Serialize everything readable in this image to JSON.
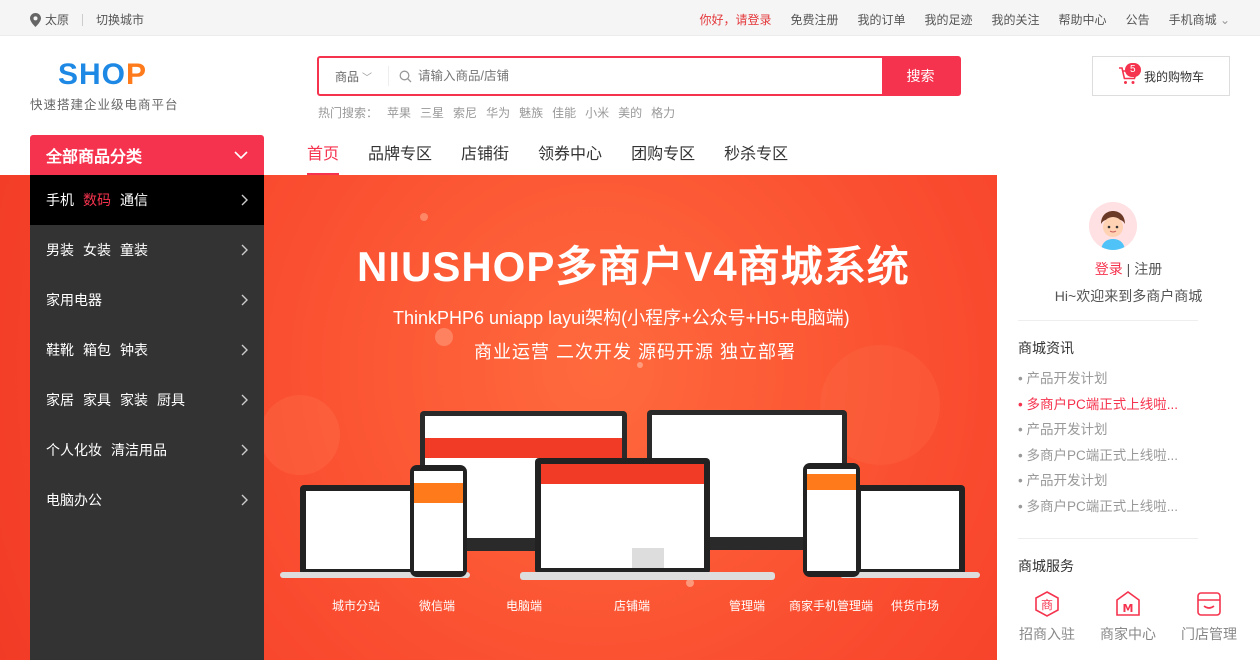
{
  "topbar": {
    "city": "太原",
    "switch_city": "切换城市",
    "links": [
      "你好，请登录",
      "免费注册",
      "我的订单",
      "我的足迹",
      "我的关注",
      "帮助中心",
      "公告",
      "手机商城"
    ]
  },
  "logo": {
    "part1": "SHO",
    "part2": "P",
    "slogan": "快速搭建企业级电商平台"
  },
  "search": {
    "category": "商品",
    "placeholder": "请输入商品/店铺",
    "button": "搜索"
  },
  "hot": {
    "label": "热门搜索：",
    "terms": [
      "苹果",
      "三星",
      "索尼",
      "华为",
      "魅族",
      "佳能",
      "小米",
      "美的",
      "格力"
    ]
  },
  "cart": {
    "count": "5",
    "label": "我的购物车"
  },
  "all_categories": "全部商品分类",
  "nav": [
    "首页",
    "品牌专区",
    "店铺街",
    "领券中心",
    "团购专区",
    "秒杀专区"
  ],
  "categories": [
    [
      "手机",
      "数码",
      "通信"
    ],
    [
      "男装",
      "女装",
      "童装"
    ],
    [
      "家用电器"
    ],
    [
      "鞋靴",
      "箱包",
      "钟表"
    ],
    [
      "家居",
      "家具",
      "家装",
      "厨具"
    ],
    [
      "个人化妆",
      "清洁用品"
    ],
    [
      "电脑办公"
    ]
  ],
  "banner": {
    "title": "NIUSHOP多商户V4商城系统",
    "sub1": "ThinkPHP6  uniapp  layui架构(小程序+公众号+H5+电脑端)",
    "sub2": "商业运营  二次开发  源码开源  独立部署",
    "labels": [
      "城市分站",
      "微信端",
      "电脑端",
      "店铺端",
      "管理端",
      "商家手机管理端",
      "供货市场"
    ]
  },
  "side": {
    "login": "登录",
    "divider": "|",
    "register": "注册",
    "welcome": "Hi~欢迎来到多商户商城",
    "news_title": "商城资讯",
    "news": [
      "产品开发计划",
      "多商户PC端正式上线啦...",
      "产品开发计划",
      "多商户PC端正式上线啦...",
      "产品开发计划",
      "多商户PC端正式上线啦..."
    ],
    "services_title": "商城服务",
    "services": [
      "招商入驻",
      "商家中心",
      "门店管理"
    ]
  },
  "colors": {
    "accent": "#f5334e",
    "banner": "#f9492e",
    "menu": "#333333"
  }
}
